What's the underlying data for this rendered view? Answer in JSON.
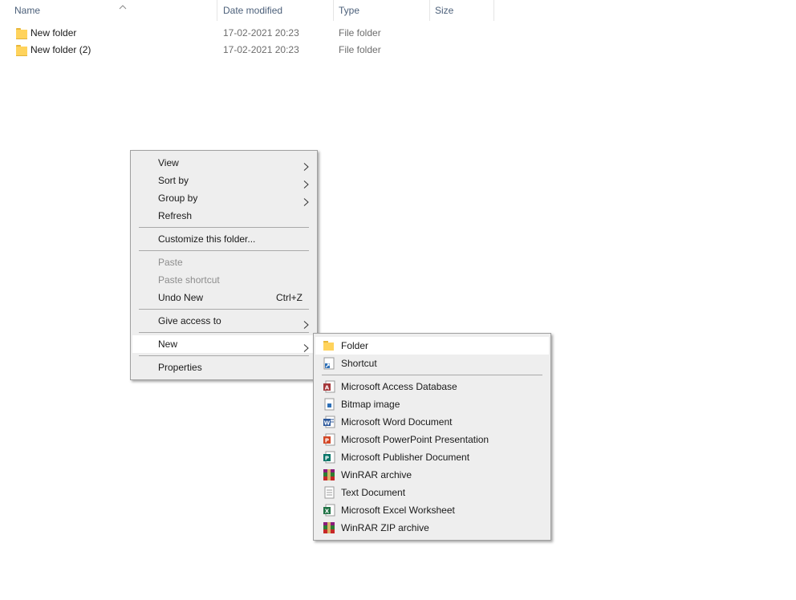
{
  "columns": {
    "name": "Name",
    "date": "Date modified",
    "type": "Type",
    "size": "Size"
  },
  "files": [
    {
      "name": "New folder",
      "date": "17-02-2021 20:23",
      "type": "File folder"
    },
    {
      "name": "New folder (2)",
      "date": "17-02-2021 20:23",
      "type": "File folder"
    }
  ],
  "context_menu": {
    "view": "View",
    "sort_by": "Sort by",
    "group_by": "Group by",
    "refresh": "Refresh",
    "customize": "Customize this folder...",
    "paste": "Paste",
    "paste_shortcut": "Paste shortcut",
    "undo_new": "Undo New",
    "undo_shortcut": "Ctrl+Z",
    "give_access": "Give access to",
    "new": "New",
    "properties": "Properties"
  },
  "new_submenu": {
    "folder": "Folder",
    "shortcut": "Shortcut",
    "access": "Microsoft Access Database",
    "bitmap": "Bitmap image",
    "word": "Microsoft Word Document",
    "powerpoint": "Microsoft PowerPoint Presentation",
    "publisher": "Microsoft Publisher Document",
    "winrar": "WinRAR archive",
    "text": "Text Document",
    "excel": "Microsoft Excel Worksheet",
    "winrar_zip": "WinRAR ZIP archive"
  },
  "icons": {
    "folder": "folder-icon",
    "shortcut": "shortcut-icon",
    "access": "access-icon",
    "bitmap": "bitmap-icon",
    "word": "word-icon",
    "powerpoint": "powerpoint-icon",
    "publisher": "publisher-icon",
    "winrar": "winrar-icon",
    "text": "text-document-icon",
    "excel": "excel-icon"
  },
  "colors": {
    "menu_bg": "#eeeeee",
    "highlight": "#ffffff",
    "folder": "#ffd35c",
    "access": "#a4373a",
    "word": "#2b579a",
    "powerpoint": "#d24726",
    "publisher": "#077568",
    "excel": "#217346"
  }
}
